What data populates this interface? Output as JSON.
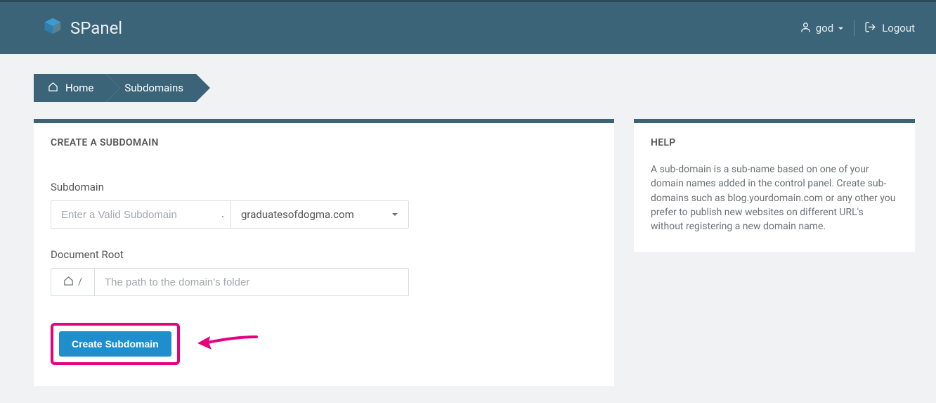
{
  "brand": {
    "name": "SPanel"
  },
  "header": {
    "username": "god",
    "logout_label": "Logout"
  },
  "breadcrumbs": {
    "home": "Home",
    "current": "Subdomains"
  },
  "main": {
    "title": "CREATE A SUBDOMAIN",
    "subdomain_label": "Subdomain",
    "subdomain_placeholder": "Enter a Valid Subdomain",
    "dot": ".",
    "domain_selected": "graduatesofdogma.com",
    "docroot_label": "Document Root",
    "path_prefix": "/",
    "docroot_placeholder": "The path to the domain's folder",
    "submit_label": "Create Subdomain"
  },
  "help": {
    "title": "HELP",
    "body": "A sub-domain is a sub-name based on one of your domain names added in the control panel. Create sub-domains such as blog.yourdomain.com or any other you prefer to publish new websites on different URL's without registering a new domain name."
  }
}
